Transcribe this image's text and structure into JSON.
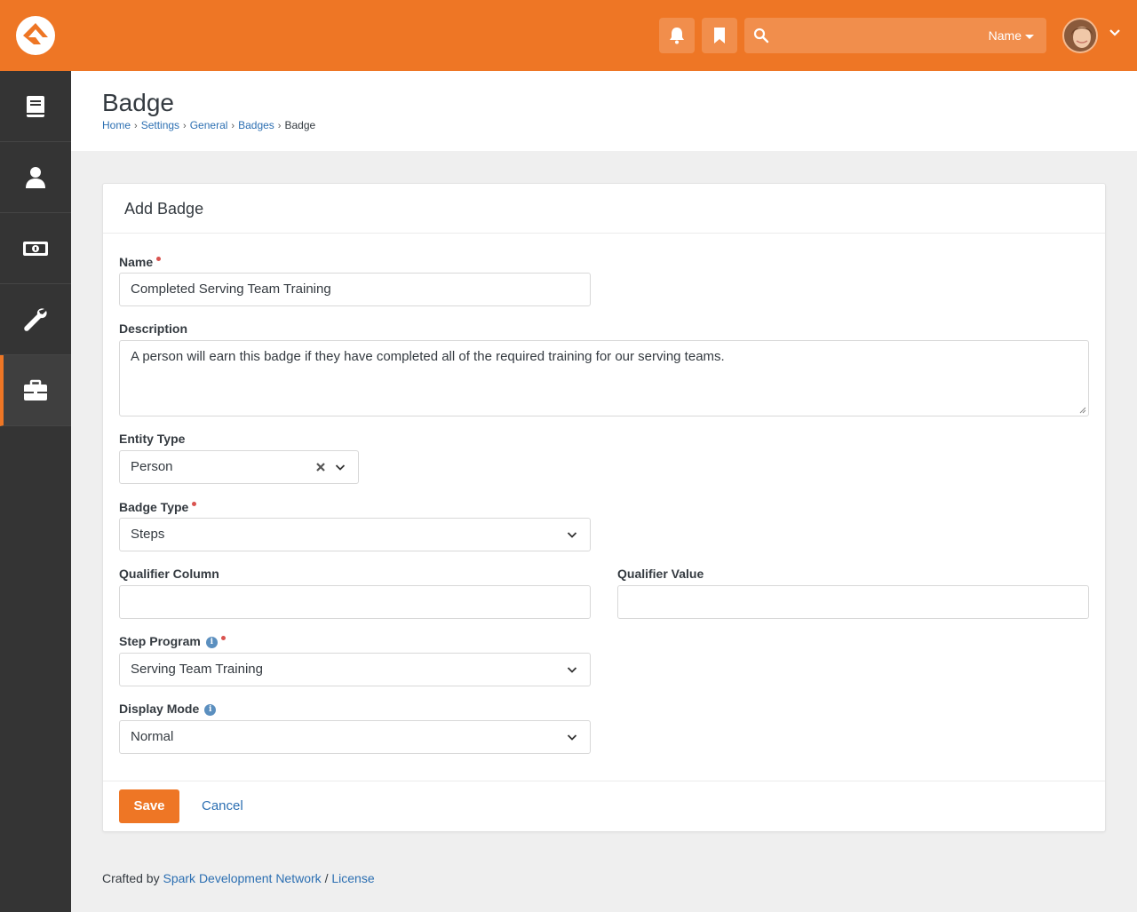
{
  "header": {
    "search_filter": "Name"
  },
  "page": {
    "title": "Badge",
    "breadcrumb": [
      "Home",
      "Settings",
      "General",
      "Badges"
    ],
    "breadcrumb_current": "Badge"
  },
  "panel": {
    "title": "Add Badge",
    "fields": {
      "name": {
        "label": "Name",
        "value": "Completed Serving Team Training"
      },
      "description": {
        "label": "Description",
        "value": "A person will earn this badge if they have completed all of the required training for our serving teams."
      },
      "entity_type": {
        "label": "Entity Type",
        "value": "Person"
      },
      "badge_type": {
        "label": "Badge Type",
        "value": "Steps"
      },
      "qualifier_column": {
        "label": "Qualifier Column",
        "value": ""
      },
      "qualifier_value": {
        "label": "Qualifier Value",
        "value": ""
      },
      "step_program": {
        "label": "Step Program",
        "value": "Serving Team Training"
      },
      "display_mode": {
        "label": "Display Mode",
        "value": "Normal"
      }
    },
    "save_label": "Save",
    "cancel_label": "Cancel"
  },
  "footer": {
    "crafted_by": "Crafted by",
    "org_link": "Spark Development Network",
    "separator": "/",
    "license_link": "License"
  },
  "colors": {
    "brand": "#ee7625",
    "sidebar": "#343434",
    "link": "#2c6fb2",
    "required": "#d9534f"
  },
  "icons": {
    "logo": "rock-logo-icon",
    "notifications": "bell-icon",
    "bookmarks": "bookmark-icon",
    "search": "search-icon",
    "sidebar": [
      "book-icon",
      "user-icon",
      "money-icon",
      "wrench-icon",
      "briefcase-icon"
    ]
  }
}
